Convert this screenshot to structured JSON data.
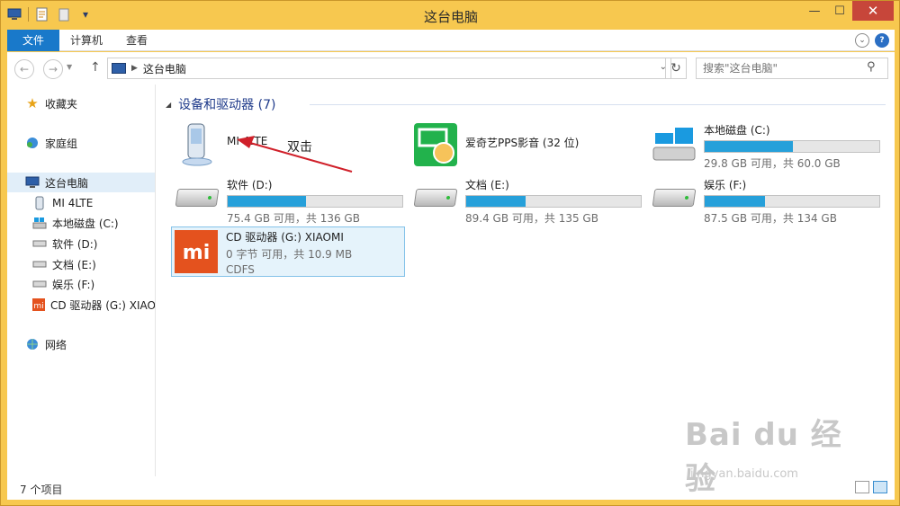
{
  "window": {
    "title": "这台电脑"
  },
  "ribbon": {
    "tabs": [
      {
        "label": "文件"
      },
      {
        "label": "计算机"
      },
      {
        "label": "查看"
      }
    ]
  },
  "address": {
    "path": "这台电脑",
    "search_placeholder": "搜索\"这台电脑\""
  },
  "sidebar": {
    "items": [
      {
        "label": "收藏夹",
        "icon": "star-icon"
      },
      {
        "label": "家庭组",
        "icon": "homegroup-icon"
      },
      {
        "label": "这台电脑",
        "icon": "computer-icon",
        "selected": true
      },
      {
        "label": "MI 4LTE",
        "icon": "phone-icon"
      },
      {
        "label": "本地磁盘 (C:)",
        "icon": "windows-drive-icon"
      },
      {
        "label": "软件 (D:)",
        "icon": "drive-icon"
      },
      {
        "label": "文档 (E:)",
        "icon": "drive-icon"
      },
      {
        "label": "娱乐 (F:)",
        "icon": "drive-icon"
      },
      {
        "label": "CD 驱动器 (G:) XIAOMI",
        "icon": "mi-icon"
      },
      {
        "label": "网络",
        "icon": "network-icon"
      }
    ]
  },
  "group": {
    "title": "设备和驱动器 (7)"
  },
  "tiles": [
    {
      "name": "MI 4LTE",
      "icon": "phone-icon"
    },
    {
      "name": "爱奇艺PPS影音 (32 位)",
      "icon": "iqiyi-icon"
    },
    {
      "name": "本地磁盘 (C:)",
      "icon": "windows-drive-icon",
      "free": "29.8 GB 可用，共 60.0 GB",
      "used_fraction": 0.503
    },
    {
      "name": "软件 (D:)",
      "icon": "drive-icon",
      "free": "75.4 GB 可用，共 136 GB",
      "used_fraction": 0.446
    },
    {
      "name": "文档 (E:)",
      "icon": "drive-icon",
      "free": "89.4 GB 可用，共 135 GB",
      "used_fraction": 0.338
    },
    {
      "name": "娱乐 (F:)",
      "icon": "drive-icon",
      "free": "87.5 GB 可用，共 134 GB",
      "used_fraction": 0.347
    },
    {
      "name": "CD 驱动器 (G:) XIAOMI",
      "icon": "mi-icon",
      "free": "0 字节 可用，共 10.9 MB",
      "fs": "CDFS",
      "selected": true
    }
  ],
  "annotation": {
    "text": "双击"
  },
  "status": {
    "count": "7 个项目"
  },
  "watermark": {
    "main": "Bai du 经验",
    "sub": "jingyan.baidu.com"
  },
  "colors": {
    "frame": "#f7c84f",
    "accent": "#1979ca",
    "bar": "#26a0da",
    "arrow": "#d0202a"
  }
}
